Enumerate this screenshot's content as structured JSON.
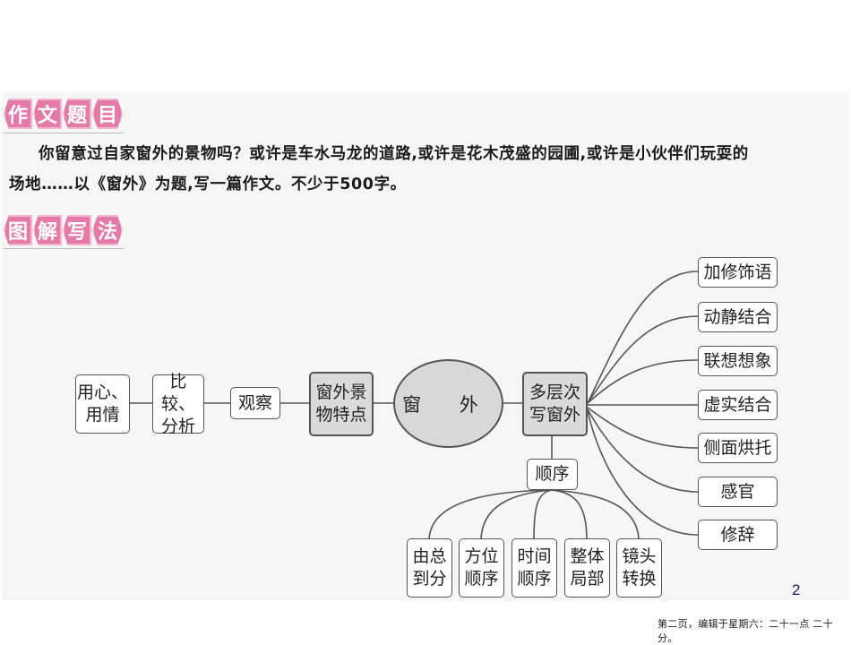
{
  "section_topic": {
    "banner_chars": [
      "作",
      "文",
      "题",
      "目"
    ],
    "paragraph_line1": "你留意过自家窗外的景物吗？或许是车水马龙的道路,或许是花木茂盛的园圃,或许是小伙伴们玩耍的",
    "paragraph_line2": "场地……以《窗外》为题,写一篇作文。不少于500字。"
  },
  "section_diagram": {
    "banner_chars": [
      "图",
      "解",
      "写",
      "法"
    ]
  },
  "mindmap": {
    "chain": [
      {
        "id": "yongxin",
        "label": "用心、\n用情"
      },
      {
        "id": "bijiao",
        "label": "比较、\n分析"
      },
      {
        "id": "guancha",
        "label": "观察"
      },
      {
        "id": "tedian",
        "label": "窗外景\n物特点"
      }
    ],
    "center": {
      "label": "窗 外"
    },
    "hub": {
      "label": "多层次\n写窗外"
    },
    "right_branches": [
      {
        "label": "加修饰语"
      },
      {
        "label": "动静结合"
      },
      {
        "label": "联想想象"
      },
      {
        "label": "虚实结合"
      },
      {
        "label": "侧面烘托"
      },
      {
        "label": "感官"
      },
      {
        "label": "修辞"
      }
    ],
    "order": {
      "label": "顺序"
    },
    "order_children": [
      {
        "label": "由总\n到分"
      },
      {
        "label": "方位\n顺序"
      },
      {
        "label": "时间\n顺序"
      },
      {
        "label": "整体\n局部"
      },
      {
        "label": "镜头\n转换"
      }
    ]
  },
  "page_number": "2",
  "footer_text": "第二页，编辑于星期六：二十一点 二十分。"
}
